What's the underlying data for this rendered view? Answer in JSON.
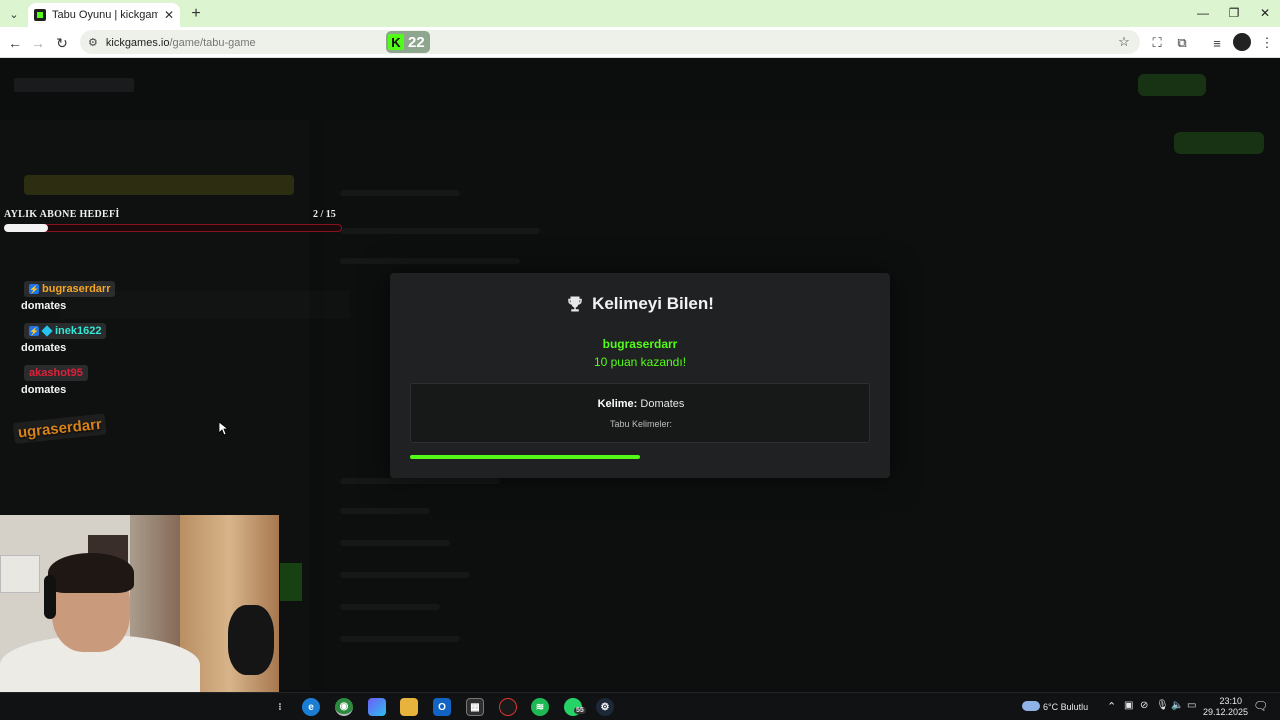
{
  "browser": {
    "tab_title": "Tabu Oyunu | kickgames.io",
    "url_host": "kickgames.io",
    "url_path": "/game/tabu-game",
    "extension_badge_letter": "K",
    "extension_badge_count": "22"
  },
  "goal": {
    "label": "AYLIK ABONE HEDEFİ",
    "count": "2 / 15",
    "progress_fraction": 0.13
  },
  "chat": [
    {
      "user": "bugraserdarr",
      "color": "#f5a623",
      "message": "domates"
    },
    {
      "user": "inek1622",
      "color": "#33e6d6",
      "message": "domates"
    },
    {
      "user": "akashot95",
      "color": "#e0203a",
      "message": "domates"
    }
  ],
  "overlay_name": "ugraserdarr",
  "modal": {
    "title": "Kelimeyi Bilen!",
    "winner": "bugraserdarr",
    "points_text": "10 puan kazandı!",
    "word_label": "Kelime:",
    "word_value": "Domates",
    "taboo_label": "Tabu Kelimeler:",
    "timer_fraction": 0.5
  },
  "taskbar": {
    "weather": "6°C Bulutlu",
    "time": "23:10",
    "date": "29.12.2025",
    "whatsapp_badge": "55"
  },
  "colors": {
    "accent_green": "#53fc18",
    "tab_strip": "#dcf4cf"
  }
}
